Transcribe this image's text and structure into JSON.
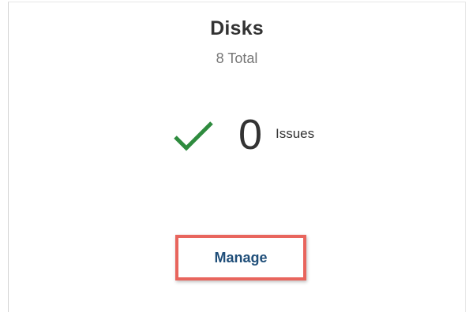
{
  "card": {
    "title": "Disks",
    "subtitle": "8 Total"
  },
  "status": {
    "icon": "check-icon",
    "count": "0",
    "label": "Issues",
    "icon_color": "#2e8b3e"
  },
  "actions": {
    "manage_label": "Manage",
    "manage_color": "#1f4e79",
    "highlight_color": "#e8655d"
  }
}
